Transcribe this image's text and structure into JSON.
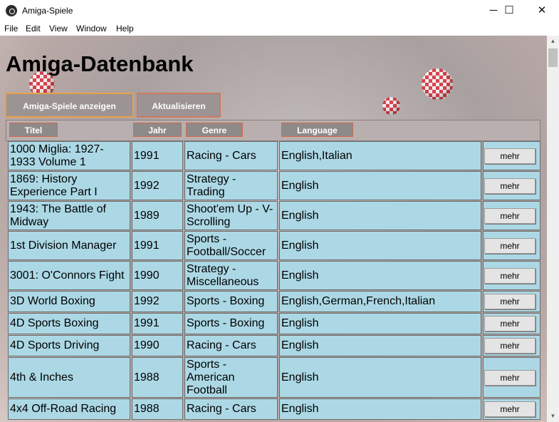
{
  "window": {
    "title": "Amiga-Spiele",
    "minimize": "─",
    "maximize": "☐",
    "close": "✕"
  },
  "menu": [
    "File",
    "Edit",
    "View",
    "Window",
    "Help"
  ],
  "page": {
    "heading": "Amiga-Datenbank",
    "buttons": {
      "show_games": "Amiga-Spiele anzeigen",
      "refresh": "Aktualisieren"
    }
  },
  "table": {
    "headers": {
      "title": "Titel",
      "year": "Jahr",
      "genre": "Genre",
      "language": "Language"
    },
    "more_label": "mehr",
    "rows": [
      {
        "title": "1000 Miglia: 1927-1933 Volume 1",
        "year": "1991",
        "genre": "Racing - Cars",
        "language": "English,Italian"
      },
      {
        "title": "1869: History Experience Part I",
        "year": "1992",
        "genre": "Strategy - Trading",
        "language": "English"
      },
      {
        "title": "1943: The Battle of Midway",
        "year": "1989",
        "genre": "Shoot'em Up - V-Scrolling",
        "language": "English"
      },
      {
        "title": "1st Division Manager",
        "year": "1991",
        "genre": "Sports - Football/Soccer",
        "language": "English"
      },
      {
        "title": "3001: O'Connors Fight",
        "year": "1990",
        "genre": "Strategy - Miscellaneous",
        "language": "English"
      },
      {
        "title": "3D World Boxing",
        "year": "1992",
        "genre": "Sports - Boxing",
        "language": "English,German,French,Italian"
      },
      {
        "title": "4D Sports Boxing",
        "year": "1991",
        "genre": "Sports - Boxing",
        "language": "English"
      },
      {
        "title": "4D Sports Driving",
        "year": "1990",
        "genre": "Racing - Cars",
        "language": "English"
      },
      {
        "title": "4th & Inches",
        "year": "1988",
        "genre": "Sports - American Football",
        "language": "English"
      },
      {
        "title": "4x4 Off-Road Racing",
        "year": "1988",
        "genre": "Racing - Cars",
        "language": "English"
      }
    ]
  },
  "scrollbar": {
    "up": "▲",
    "down": "▼"
  },
  "colors": {
    "cell_bg": "#acd8e5",
    "button_bg": "#9c9494",
    "button_border": "#d07a5c"
  }
}
